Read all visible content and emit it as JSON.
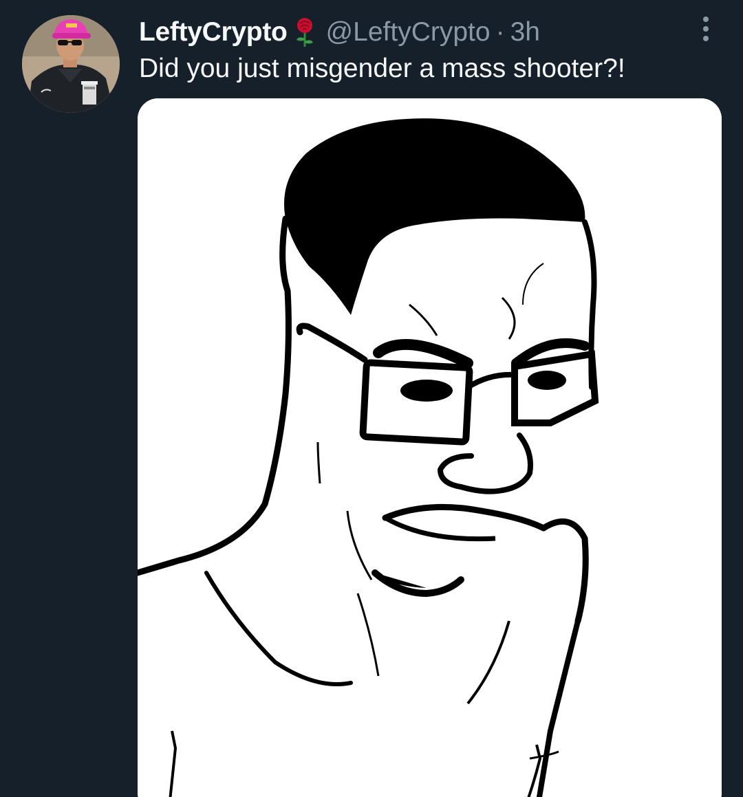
{
  "tweet": {
    "author": {
      "display_name": "LeftyCrypto",
      "badge_icon": "rose-icon",
      "handle": "@LeftyCrypto",
      "separator": "·",
      "timestamp": "3h"
    },
    "text": "Did you just misgender a mass shooter?!",
    "media": {
      "type": "image",
      "subject": "meme-face-drawing"
    },
    "more_icon": "more-vertical-icon"
  },
  "colors": {
    "background": "#15202b",
    "primary_text": "#f7f9f9",
    "secondary_text": "#8b98a5",
    "media_background": "#ffffff"
  }
}
